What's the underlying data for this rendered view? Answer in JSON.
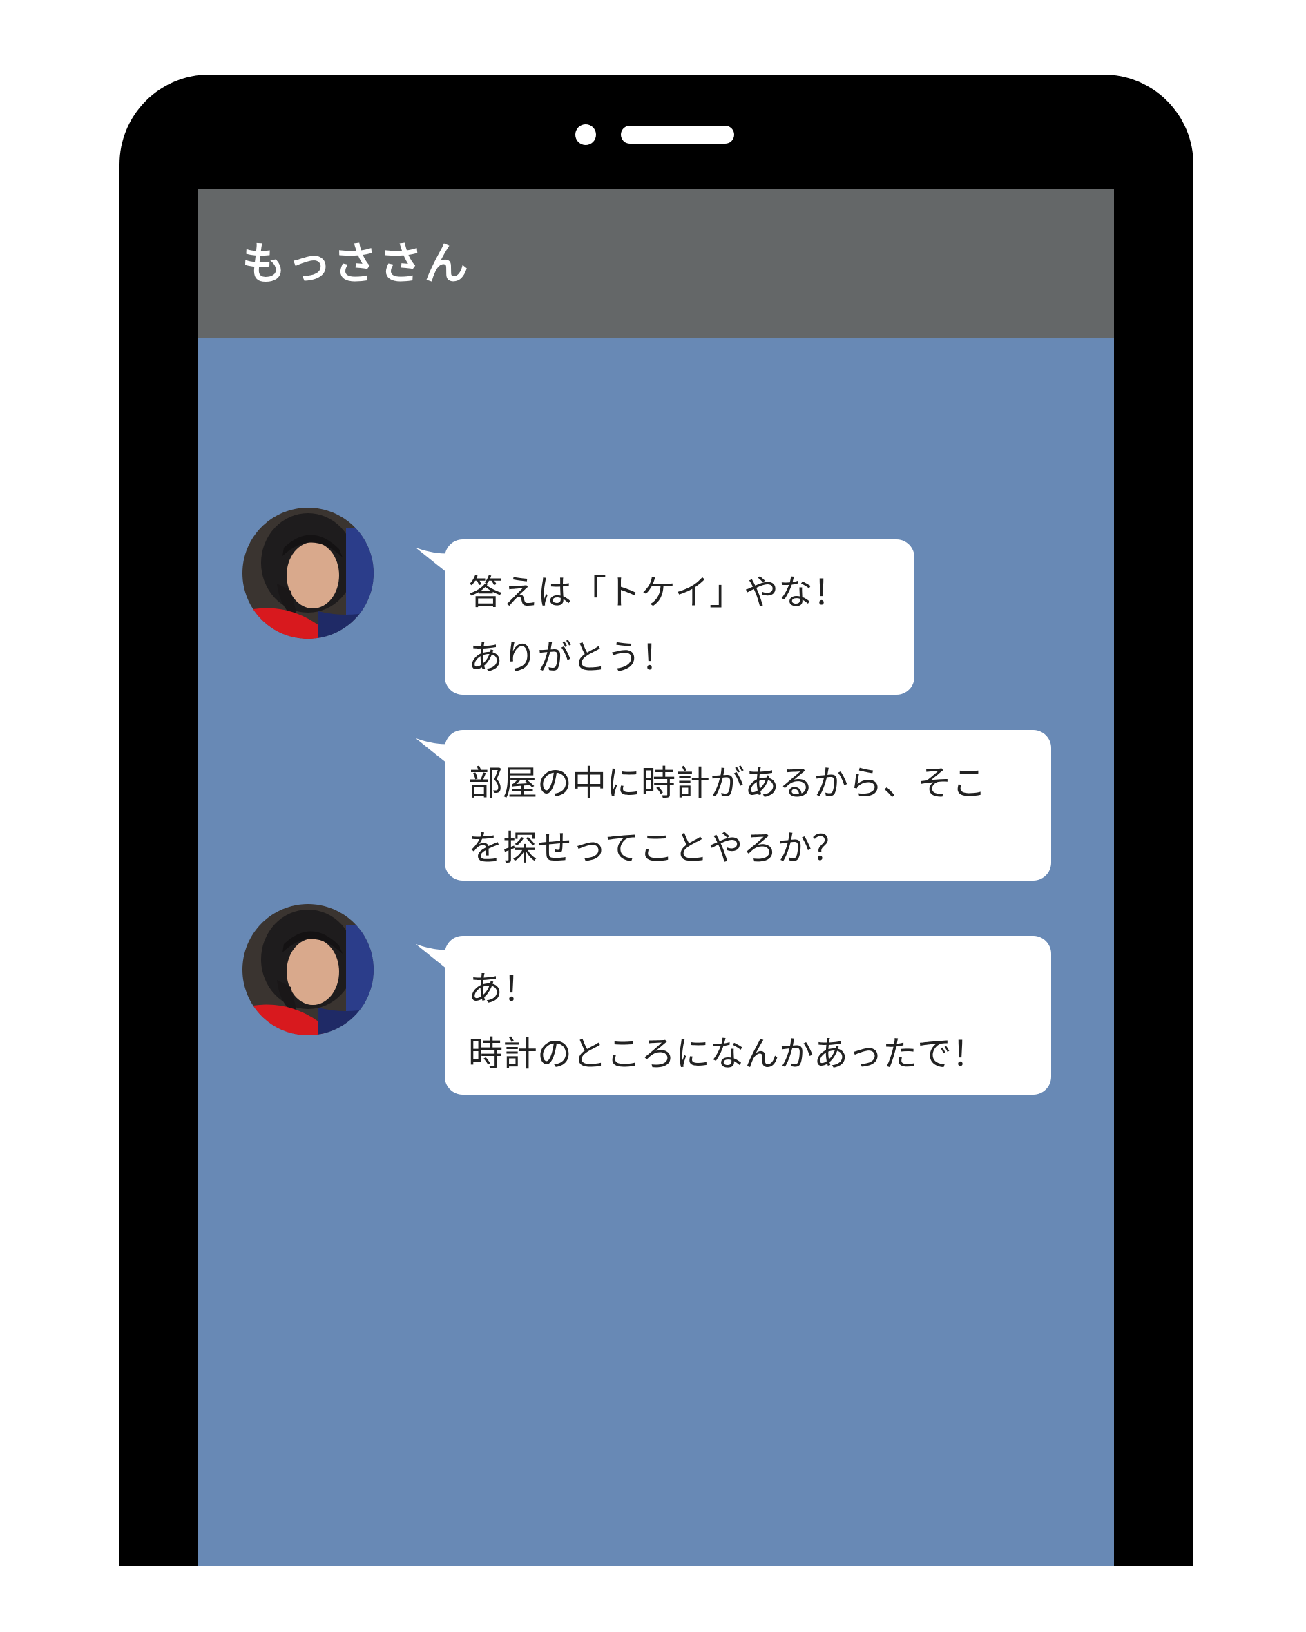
{
  "chat": {
    "contact_name": "もっささん",
    "messages": [
      {
        "sender": "もっささん",
        "has_avatar": true,
        "lines": [
          "答えは「トケイ」やな！",
          "ありがとう！"
        ]
      },
      {
        "sender": "もっささん",
        "has_avatar": false,
        "lines": [
          "部屋の中に時計があるから、そこ",
          "を探せってことやろか？"
        ]
      },
      {
        "sender": "もっささん",
        "has_avatar": true,
        "lines": [
          "あ！",
          "時計のところになんかあったで！"
        ]
      }
    ]
  },
  "colors": {
    "page_background": "#ffffff",
    "device_frame": "#000000",
    "header_background": "#646768",
    "chat_background": "#6889b5",
    "bubble_background": "#ffffff",
    "text": "#222222"
  }
}
